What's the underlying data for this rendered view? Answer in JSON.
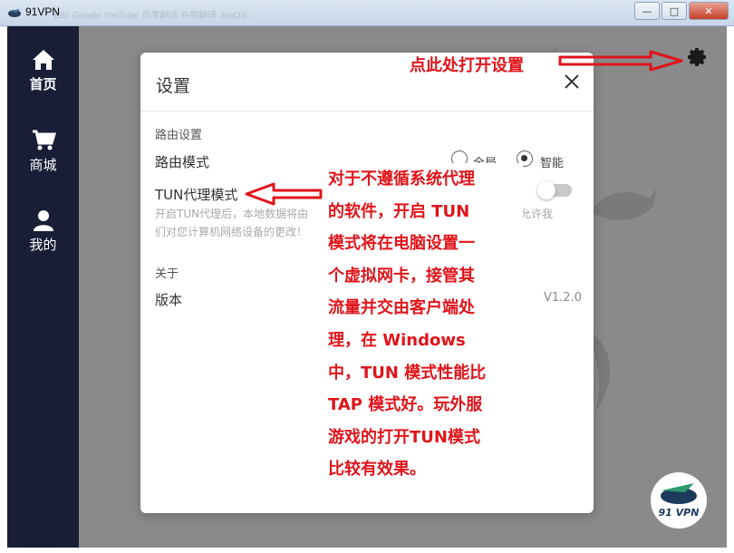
{
  "window": {
    "title": "91VPN",
    "faint_tabs": "Ello    Google    YouTube    百度翻译    谷歌翻译    JiraOS    ..."
  },
  "window_buttons": {
    "minimize": "—",
    "maximize": "□",
    "close": "✕"
  },
  "sidebar": {
    "items": [
      {
        "label": "首页",
        "icon": "home-icon",
        "active": true
      },
      {
        "label": "商城",
        "icon": "cart-icon",
        "active": false
      },
      {
        "label": "我的",
        "icon": "user-icon",
        "active": false
      }
    ]
  },
  "settings_modal": {
    "title": "设置",
    "route_section": "路由设置",
    "route_mode_label": "路由模式",
    "route_options": [
      {
        "label": "全局",
        "selected": false
      },
      {
        "label": "智能",
        "selected": true
      }
    ],
    "tun_label": "TUN代理模式",
    "tun_enabled": false,
    "tun_hint_line1": "开启TUN代理后，本地数据将由",
    "tun_hint_line1_right": "代理",
    "tun_hint_line1_right2": "连接断开时，请允许我",
    "tun_hint_line2": "们对您计算机网络设备的更改！",
    "about_section": "关于",
    "version_label": "版本",
    "version_value": "V1.2.0"
  },
  "annotations": {
    "open_settings": "点此处打开设置",
    "tun_explanation_lines": [
      "对于不遵循系统代理",
      "的软件，开启 TUN",
      "模式将在电脑设置一",
      "个虚拟网卡，接管其",
      "流量并交由客户端处",
      "理，在 Windows",
      "中，TUN 模式性能比",
      "TAP 模式好。玩外服",
      "游戏的打开TUN模式",
      "比较有效果。"
    ]
  },
  "logo": {
    "text": "91 VPN"
  },
  "colors": {
    "sidebar_bg": "#191d36",
    "overlay": "#7f7f7f",
    "annotation_red": "#e0141a"
  }
}
